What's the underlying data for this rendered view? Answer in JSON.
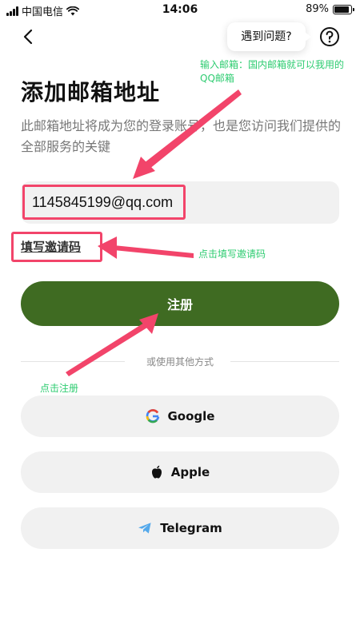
{
  "status_bar": {
    "carrier": "中国电信",
    "time": "14:06",
    "battery": "89%",
    "battery_level": 0.89
  },
  "header": {
    "help_label": "遇到问题?"
  },
  "main": {
    "title": "添加邮箱地址",
    "subtitle": "此邮箱地址将成为您的登录账号，也是您访问我们提供的全部服务的关键",
    "email_value": "1145845199@qq.com",
    "invite_link": "填写邀请码",
    "register_label": "注册",
    "divider_text": "或使用其他方式"
  },
  "social": [
    {
      "label": "Google",
      "icon": "google-icon"
    },
    {
      "label": "Apple",
      "icon": "apple-icon"
    },
    {
      "label": "Telegram",
      "icon": "telegram-icon"
    }
  ],
  "annotations": {
    "email_note": "输入邮箱：国内邮箱就可以我用的QQ邮箱",
    "invite_note": "点击填写邀请码",
    "register_note": "点击注册"
  },
  "colors": {
    "primary_button": "#3f6b22",
    "annotation_arrow": "#f2446a",
    "annotation_text": "#2ecc71"
  }
}
